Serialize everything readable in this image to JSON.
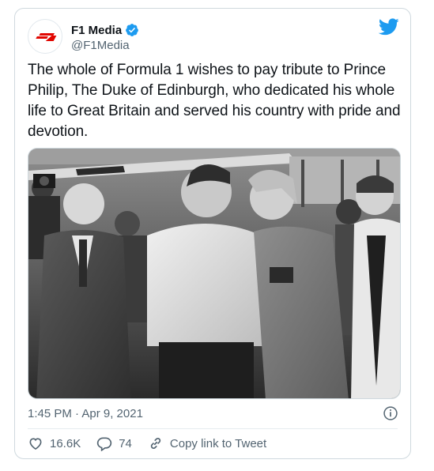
{
  "user": {
    "display_name": "F1 Media",
    "handle": "@F1Media",
    "verified": true,
    "avatar_icon": "f1-logo-icon"
  },
  "tweet": {
    "text": "The whole of Formula 1 wishes to pay tribute to Prince Philip, The Duke of Edinburgh, who dedicated his whole life to Great Britain and served his country with pride and devotion.",
    "image_icon": "black-and-white-photo",
    "timestamp": "1:45 PM · Apr 9, 2021"
  },
  "actions": {
    "likes": "16.6K",
    "replies": "74",
    "copy_link": "Copy link to Tweet"
  },
  "colors": {
    "twitter_blue": "#1d9bf0",
    "f1_red": "#e10600",
    "secondary_text": "#536471"
  }
}
